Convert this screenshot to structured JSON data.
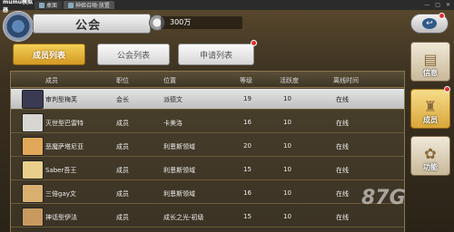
{
  "emulator": {
    "logo": "mumu模拟器",
    "tabs": [
      {
        "label": "桌面",
        "active": false
      },
      {
        "label": "神姬召喚·放置",
        "active": true
      }
    ],
    "window_controls": [
      "—",
      "□",
      "✕"
    ]
  },
  "header": {
    "title": "公会",
    "game_tab_label": "神姬召喚·放置",
    "currency_value": "300万",
    "back_icon": "back-arrow-icon"
  },
  "subtabs": [
    {
      "label": "成员列表",
      "active": true
    },
    {
      "label": "公会列表",
      "active": false
    },
    {
      "label": "申请列表",
      "active": false,
      "badge": true
    }
  ],
  "table": {
    "columns": [
      "成员",
      "职位",
      "位置",
      "等级",
      "活跃度",
      "离线时间"
    ],
    "rows": [
      {
        "name": "审判型梅芙",
        "role": "会长",
        "location": "派德文",
        "level": "19",
        "activity": "10",
        "offline": "在线",
        "selected": true,
        "avatar_color": "#3a3a52"
      },
      {
        "name": "灭世型巴雷特",
        "role": "成员",
        "location": "卡美洛",
        "level": "16",
        "activity": "10",
        "offline": "在线",
        "selected": false,
        "avatar_color": "#d8d6d0"
      },
      {
        "name": "恶魔萨塔尼亚",
        "role": "成员",
        "location": "利恩斯领域",
        "level": "20",
        "activity": "10",
        "offline": "在线",
        "selected": false,
        "avatar_color": "#e2a85a"
      },
      {
        "name": "Saber吾王",
        "role": "成员",
        "location": "利恩斯领域",
        "level": "15",
        "activity": "10",
        "offline": "在线",
        "selected": false,
        "avatar_color": "#e8cf8a"
      },
      {
        "name": "三倍gay文",
        "role": "成员",
        "location": "利恩斯领域",
        "level": "16",
        "activity": "10",
        "offline": "在线",
        "selected": false,
        "avatar_color": "#d9b070"
      },
      {
        "name": "神话型伊法",
        "role": "成员",
        "location": "成长之光-初级",
        "level": "15",
        "activity": "10",
        "offline": "在线",
        "selected": false,
        "avatar_color": "#c89a60"
      }
    ]
  },
  "sidebar": {
    "buttons": [
      {
        "label": "信息",
        "icon": "scroll-icon",
        "active": false
      },
      {
        "label": "成员",
        "icon": "member-icon",
        "active": true,
        "badge": true
      },
      {
        "label": "功能",
        "icon": "function-icon",
        "active": false
      }
    ]
  },
  "watermark": "87G"
}
